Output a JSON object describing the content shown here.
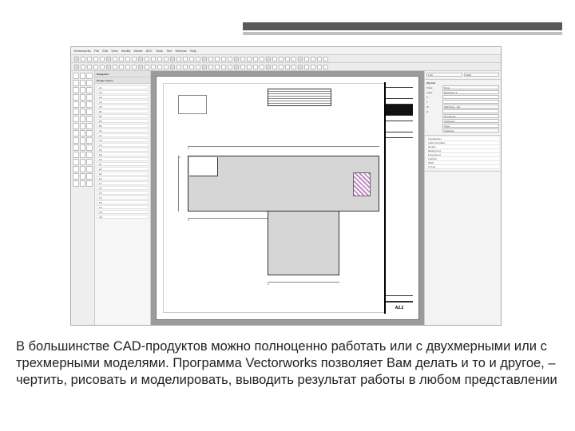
{
  "header": {},
  "app": {
    "menubar": [
      "Vectorworks",
      "File",
      "Edit",
      "View",
      "Modify",
      "Model",
      "AEC",
      "Tools",
      "Text",
      "Window",
      "Help"
    ],
    "toolbar_buttons": 40,
    "toolpalette_rows": 16,
    "left_panel": {
      "title": "Navigation",
      "layer_header": "Design Layers",
      "layers": [
        "A1",
        "A2",
        "A3",
        "A4",
        "A5",
        "B1",
        "B2",
        "B3",
        "B4",
        "C1",
        "C2",
        "C3",
        "C4",
        "D1",
        "D2",
        "D3",
        "E1",
        "E2",
        "E3",
        "E4",
        "F1",
        "F2",
        "F3",
        "F4",
        "F5",
        "G1",
        "G2",
        "G3"
      ]
    },
    "canvas": {
      "sheet_label": "A2.2",
      "schedule_title": "SCHEDULE",
      "dims": {
        "a": "C",
        "b": "C",
        "c": "C",
        "d": "C"
      }
    },
    "right_panel": {
      "obj_info": "Obj Info",
      "scale_label": "1:50",
      "zoom": "100%",
      "fields": [
        {
          "l": "Class",
          "v": "None"
        },
        {
          "l": "Layer",
          "v": "Mod-Floor-1"
        },
        {
          "l": "X",
          "v": ""
        },
        {
          "l": "Y",
          "v": ""
        },
        {
          "l": "W",
          "v": "Wall Style - Ext"
        },
        {
          "l": "H",
          "v": ""
        },
        {
          "l": "",
          "v": "Top Bound"
        },
        {
          "l": "",
          "v": "Thickness"
        },
        {
          "l": "",
          "v": "Caps"
        },
        {
          "l": "",
          "v": "Attributes"
        }
      ],
      "lines": [
        "Visualization",
        "Class Overrides",
        "Render",
        "Background",
        "Foreground",
        "Ambient",
        "HDRI",
        "Lit Fog"
      ]
    }
  },
  "caption": "В большинстве CAD-продуктов можно полноценно работать или с двухмерными или с трехмерными моделями. Программа Vectorworks позволяет Вам делать и то и другое, – чертить, рисовать и моделировать, выводить результат работы в любом представлении"
}
